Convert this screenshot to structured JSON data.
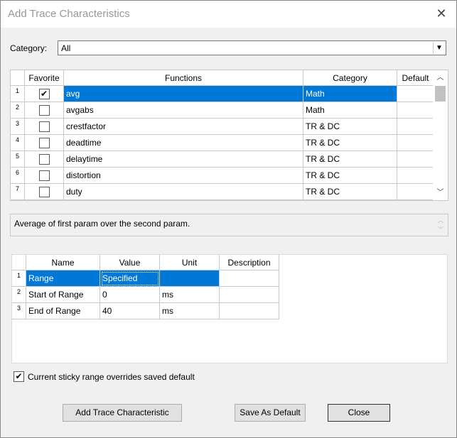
{
  "window": {
    "title": "Add Trace Characteristics",
    "close_icon": "close-icon"
  },
  "category": {
    "label": "Category:",
    "value": "All"
  },
  "functions_grid": {
    "headers": {
      "favorite": "Favorite",
      "functions": "Functions",
      "category": "Category",
      "default": "Default"
    },
    "rows": [
      {
        "num": "1",
        "favorite": true,
        "name": "avg",
        "category": "Math",
        "default": "",
        "selected": true
      },
      {
        "num": "2",
        "favorite": false,
        "name": "avgabs",
        "category": "Math",
        "default": ""
      },
      {
        "num": "3",
        "favorite": false,
        "name": "crestfactor",
        "category": "TR & DC",
        "default": ""
      },
      {
        "num": "4",
        "favorite": false,
        "name": "deadtime",
        "category": "TR & DC",
        "default": ""
      },
      {
        "num": "5",
        "favorite": false,
        "name": "delaytime",
        "category": "TR & DC",
        "default": ""
      },
      {
        "num": "6",
        "favorite": false,
        "name": "distortion",
        "category": "TR & DC",
        "default": ""
      },
      {
        "num": "7",
        "favorite": false,
        "name": "duty",
        "category": "TR & DC",
        "default": ""
      }
    ]
  },
  "description": "Average of first param over the second param.",
  "params_grid": {
    "headers": {
      "name": "Name",
      "value": "Value",
      "unit": "Unit",
      "description": "Description"
    },
    "rows": [
      {
        "num": "1",
        "name": "Range",
        "value": "Specified",
        "unit": "",
        "description": "",
        "selected": true
      },
      {
        "num": "2",
        "name": "Start of Range",
        "value": "0",
        "unit": "ms",
        "description": ""
      },
      {
        "num": "3",
        "name": "End of Range",
        "value": "40",
        "unit": "ms",
        "description": ""
      }
    ]
  },
  "sticky": {
    "checked": true,
    "label": "Current sticky range overrides saved default"
  },
  "buttons": {
    "add": "Add Trace Characteristic",
    "save_default": "Save As Default",
    "close": "Close"
  },
  "colors": {
    "selection": "#0078d7",
    "dialog_bg": "#f0f0f0"
  }
}
